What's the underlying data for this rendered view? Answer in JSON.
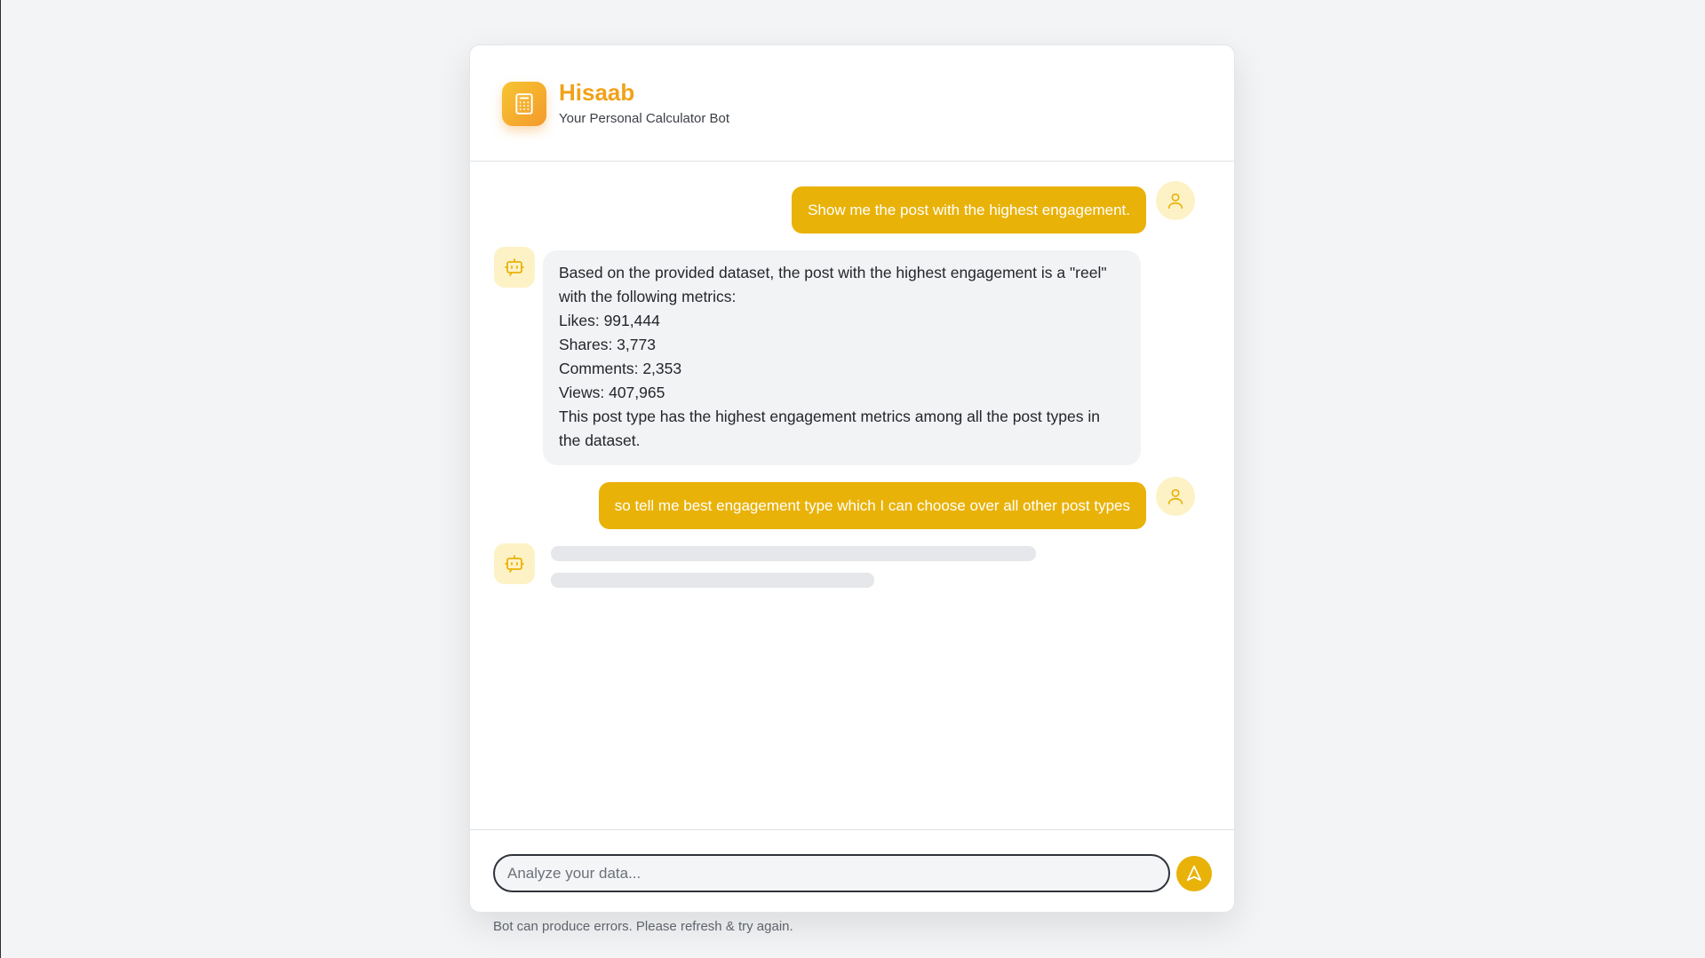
{
  "header": {
    "title": "Hisaab",
    "subtitle": "Your Personal Calculator Bot",
    "logo_icon": "calculator-icon"
  },
  "messages": [
    {
      "role": "user",
      "text": "Show me the post with the highest engagement."
    },
    {
      "role": "bot",
      "lines": [
        "Based on the provided dataset, the post with the highest engagement is a \"reel\" with the following metrics:",
        "Likes: 991,444",
        "Shares: 3,773",
        "Comments: 2,353",
        "Views: 407,965",
        "This post type has the highest engagement metrics among all the post types in the dataset."
      ]
    },
    {
      "role": "user",
      "text": "so tell me best engagement type which I can choose over all other post types"
    },
    {
      "role": "bot",
      "loading": true
    }
  ],
  "composer": {
    "placeholder": "Analyze your data...",
    "value": "",
    "send_icon": "send-icon"
  },
  "footer": {
    "disclaimer": "Bot can produce errors. Please refresh & try again."
  },
  "colors": {
    "accent": "#e9b208",
    "title": "#f0a21a",
    "avatar_bg": "#fdf2c6",
    "bot_bubble": "#f2f3f5"
  }
}
